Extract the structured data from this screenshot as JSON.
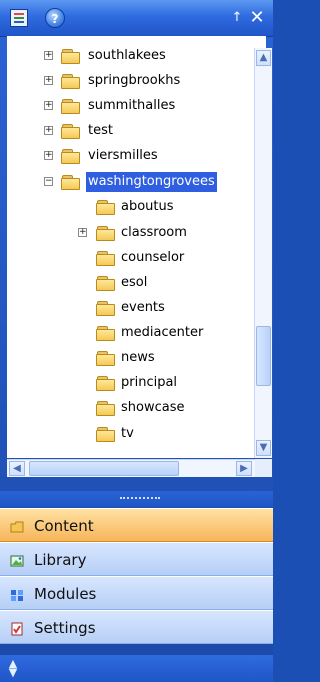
{
  "header": {
    "pin_glyph": "↑",
    "close_glyph": "✕"
  },
  "tree": {
    "top_nodes": [
      {
        "label": "southlakees",
        "collapsed": true
      },
      {
        "label": "springbrookhs",
        "collapsed": true
      },
      {
        "label": "summithalles",
        "collapsed": true
      },
      {
        "label": "test",
        "collapsed": true
      },
      {
        "label": "viersmilles",
        "collapsed": true
      },
      {
        "label": "washingtongrovees",
        "expanded": true,
        "selected": true
      }
    ],
    "children": [
      {
        "label": "aboutus"
      },
      {
        "label": "classroom",
        "collapsed": true
      },
      {
        "label": "counselor"
      },
      {
        "label": "esol"
      },
      {
        "label": "events"
      },
      {
        "label": "mediacenter"
      },
      {
        "label": "news"
      },
      {
        "label": "principal"
      },
      {
        "label": "showcase"
      },
      {
        "label": "tv"
      }
    ]
  },
  "scrollbars": {
    "vertical": {
      "up_glyph": "▲",
      "down_glyph": "▼"
    },
    "horizontal": {
      "left_glyph": "◀",
      "right_glyph": "▶"
    }
  },
  "nav": {
    "items": [
      {
        "label": "Content",
        "icon": "folder-icon",
        "active": true
      },
      {
        "label": "Library",
        "icon": "image-icon",
        "active": false
      },
      {
        "label": "Modules",
        "icon": "modules-icon",
        "active": false
      },
      {
        "label": "Settings",
        "icon": "settings-icon",
        "active": false
      }
    ]
  },
  "colors": {
    "accent": "#2f5fe0",
    "header_blue": "#2f6be0",
    "active_orange": "#f6b55a"
  }
}
